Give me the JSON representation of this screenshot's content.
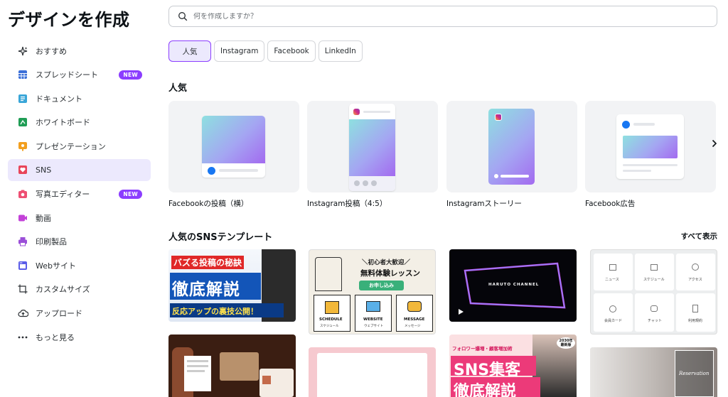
{
  "sidebar": {
    "title": "デザインを作成",
    "items": [
      {
        "label": "おすすめ",
        "icon": "sparkle-icon"
      },
      {
        "label": "スプレッドシート",
        "icon": "spreadsheet-icon",
        "badge": "NEW"
      },
      {
        "label": "ドキュメント",
        "icon": "document-icon"
      },
      {
        "label": "ホワイトボード",
        "icon": "whiteboard-icon"
      },
      {
        "label": "プレゼンテーション",
        "icon": "presentation-icon"
      },
      {
        "label": "SNS",
        "icon": "heart-icon",
        "active": true
      },
      {
        "label": "写真エディター",
        "icon": "camera-icon",
        "badge": "NEW"
      },
      {
        "label": "動画",
        "icon": "video-icon"
      },
      {
        "label": "印刷製品",
        "icon": "printer-icon"
      },
      {
        "label": "Webサイト",
        "icon": "website-icon"
      },
      {
        "label": "カスタムサイズ",
        "icon": "custom-size-icon"
      },
      {
        "label": "アップロード",
        "icon": "cloud-upload-icon"
      },
      {
        "label": "もっと見る",
        "icon": "more-dots-icon"
      }
    ]
  },
  "search": {
    "placeholder": "何を作成しますか？"
  },
  "chips": [
    {
      "label": "人気",
      "active": true
    },
    {
      "label": "Instagram"
    },
    {
      "label": "Facebook"
    },
    {
      "label": "LinkedIn"
    }
  ],
  "popular": {
    "title": "人気",
    "cards": [
      {
        "label": "Facebookの投稿（横）"
      },
      {
        "label": "Instagram投稿（4:5）"
      },
      {
        "label": "Instagramストーリー"
      },
      {
        "label": "Facebook広告"
      }
    ]
  },
  "templates": {
    "title": "人気のSNSテンプレート",
    "see_all": "すべて表示",
    "t1": {
      "line1": "バズる投稿の秘訣",
      "line2": "徹底解説",
      "line3": "反応アップの裏技公開！"
    },
    "t2": {
      "line1": "＼初心者大歓迎／",
      "line2": "無料体験レッスン",
      "button": "お申し込み",
      "icons": [
        "SCHEDULE",
        "WEBSITE",
        "MESSAGE"
      ],
      "icon_sub": [
        "スケジュール",
        "ウェブサイト",
        "メッセージ"
      ]
    },
    "t3": {
      "text": "HARUTO CHANNEL"
    },
    "t4": {
      "cells": [
        "ニュース",
        "スケジュール",
        "アクセス",
        "会員カード",
        "チャット",
        "利用規約"
      ]
    },
    "t7": {
      "line0": "フォロワー爆増・顧客増加術",
      "line1": "SNS集客",
      "line2": "徹底解説",
      "corner": "2030年最新版"
    },
    "t8": {
      "text": "Reservation"
    }
  },
  "colors": {
    "accent": "#8b3dff",
    "active_bg": "#ece9fd"
  }
}
